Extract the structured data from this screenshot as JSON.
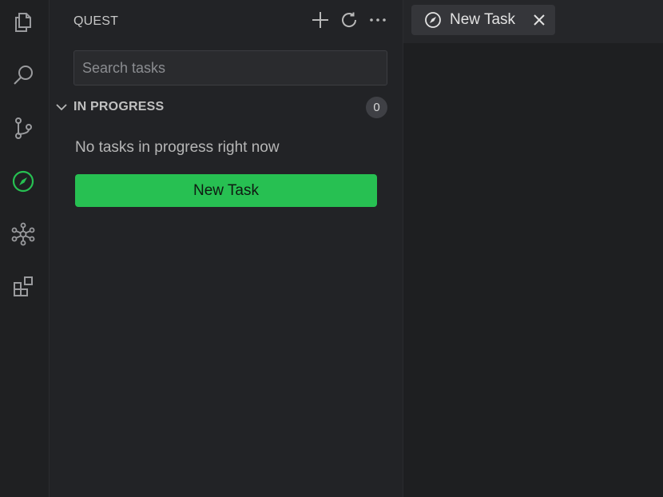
{
  "activity_bar": {
    "items": [
      {
        "icon": "files-icon"
      },
      {
        "icon": "search-icon"
      },
      {
        "icon": "source-control-icon"
      },
      {
        "icon": "compass-icon",
        "active": true
      },
      {
        "icon": "graph-nodes-icon"
      },
      {
        "icon": "extensions-icon"
      }
    ]
  },
  "sidebar": {
    "title": "QUEST",
    "actions": [
      "plus-icon",
      "refresh-icon",
      "more-icon"
    ],
    "search": {
      "placeholder": "Search tasks",
      "value": ""
    },
    "section": {
      "title": "IN PROGRESS",
      "count": "0"
    },
    "empty_message": "No tasks in progress right now",
    "new_task_label": "New Task"
  },
  "editor": {
    "tabs": [
      {
        "label": "New Task",
        "icon": "compass-icon"
      }
    ]
  },
  "colors": {
    "accent": "#27c052",
    "background": "#1e1f21",
    "sidebar": "#222326",
    "tab_active": "#35363a"
  }
}
